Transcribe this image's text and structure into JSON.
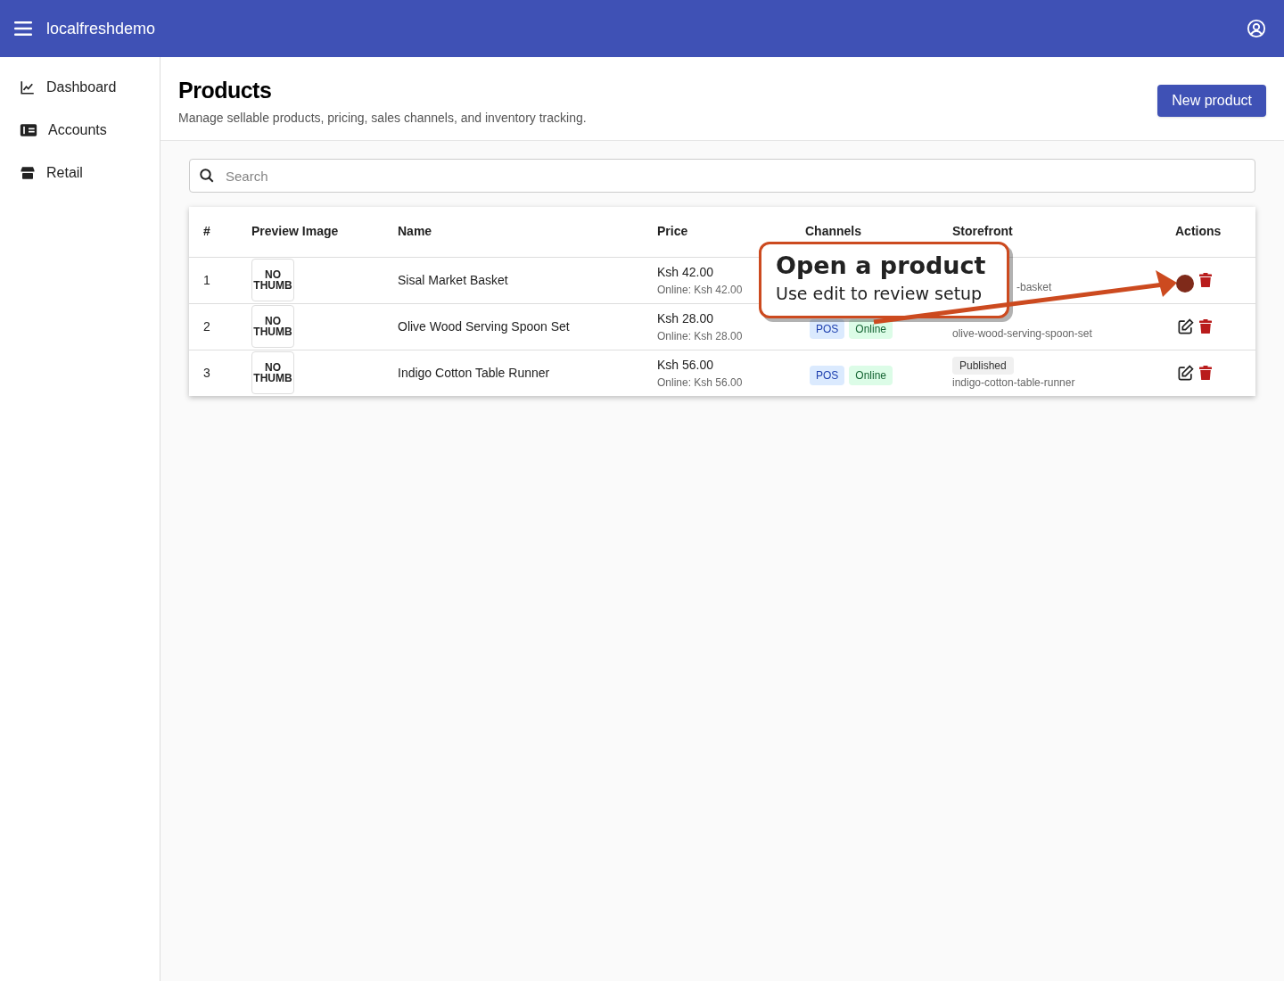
{
  "app_bar": {
    "title": "localfreshdemo"
  },
  "sidebar": {
    "items": [
      {
        "label": "Dashboard",
        "kind": "chart"
      },
      {
        "label": "Accounts",
        "kind": "money"
      },
      {
        "label": "Retail",
        "kind": "store"
      }
    ]
  },
  "page": {
    "title": "Products",
    "subtitle": "Manage sellable products, pricing, sales channels, and inventory tracking.",
    "new_button": "New product"
  },
  "search": {
    "placeholder": "Search"
  },
  "table": {
    "columns": [
      "#",
      "Preview Image",
      "Name",
      "Price",
      "Channels",
      "Storefront",
      "Actions"
    ],
    "rows": [
      {
        "index": "1",
        "thumb": "NO THUMB",
        "name": "Sisal Market Basket",
        "price": "Ksh 42.00",
        "online_price": "Online: Ksh 42.00",
        "channels": [],
        "slug": "-basket",
        "actions": [
          {
            "kind": "delete"
          }
        ]
      },
      {
        "index": "2",
        "thumb": "NO THUMB",
        "name": "Olive Wood Serving Spoon Set",
        "price": "Ksh 28.00",
        "online_price": "Online: Ksh 28.00",
        "channels": [
          {
            "label": "POS",
            "kind": "pos"
          },
          {
            "label": "Online",
            "kind": "online"
          }
        ],
        "slug": "olive-wood-serving-spoon-set",
        "actions": [
          {
            "kind": "edit"
          },
          {
            "kind": "delete"
          }
        ]
      },
      {
        "index": "3",
        "thumb": "NO THUMB",
        "name": "Indigo Cotton Table Runner",
        "price": "Ksh 56.00",
        "online_price": "Online: Ksh 56.00",
        "channels": [
          {
            "label": "POS",
            "kind": "pos"
          },
          {
            "label": "Online",
            "kind": "online"
          }
        ],
        "status": "Published",
        "slug": "indigo-cotton-table-runner",
        "actions": [
          {
            "kind": "edit"
          },
          {
            "kind": "delete"
          }
        ]
      }
    ]
  },
  "callout": {
    "title": "Open a product",
    "text": "Use edit to review setup"
  }
}
